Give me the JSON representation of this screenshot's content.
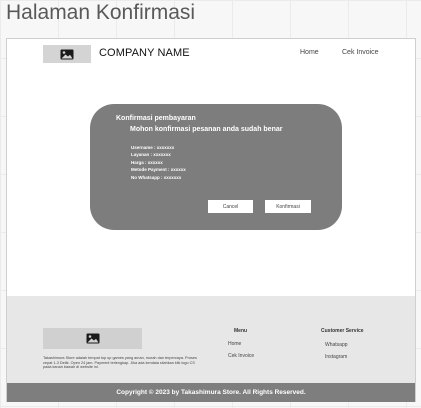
{
  "page": {
    "heading": "Halaman Konfirmasi"
  },
  "navbar": {
    "logo_icon": "image-icon",
    "company_name": "COMPANY NAME",
    "links": [
      {
        "label": "Home"
      },
      {
        "label": "Cek Invoice"
      }
    ]
  },
  "modal": {
    "title": "Konfirmasi pembayaran",
    "subtitle": "Mohon konfirmasi pesanan anda sudah benar",
    "details": [
      "Username : xxxxxxx",
      "Layanan : xxxxxxx",
      "Harga : xxxxxx",
      "Metode Payment : xxxxxx",
      "No Whatsapp : xxxxxxx"
    ],
    "cancel_label": "Cancel",
    "confirm_label": "Konfirmasi"
  },
  "footer": {
    "logo_icon": "image-icon",
    "description": "Takashimura Store adalah tempat top up games yang aman, murah dan terpercaya. Proses cepat 1-3 Detik. Open 24 jam. Payment terlengkap. Jika ada kendala silahkan klik logo CS pada kanan bawah di website ini.",
    "menu_title": "Menu",
    "menu_links": [
      {
        "label": "Home"
      },
      {
        "label": "Cek Invoice"
      }
    ],
    "cs_title": "Customer Service",
    "cs_links": [
      {
        "label": "Whatsapp"
      },
      {
        "label": "Instagram"
      }
    ]
  },
  "copyright": "Copyright © 2023 by Takashimura Store. All Rights Reserved.",
  "colors": {
    "modal_bg": "#7d7d7d",
    "footer_bg": "#e7e7e7",
    "copyright_bg": "#7e7e7e",
    "placeholder": "#d4d4d4"
  }
}
